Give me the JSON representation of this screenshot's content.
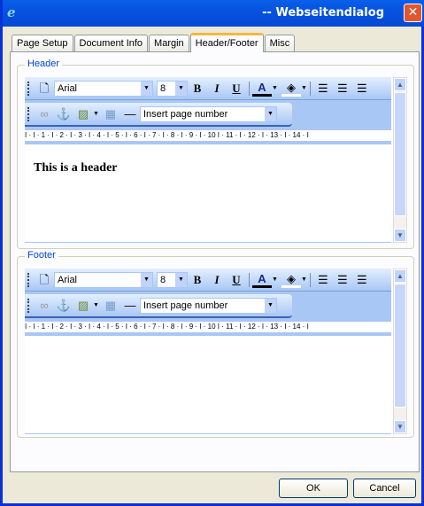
{
  "window": {
    "title": "-- Webseitendialog",
    "icon": "ie-icon",
    "close_icon": "close-icon"
  },
  "tabs": [
    {
      "label": "Page Setup"
    },
    {
      "label": "Document Info"
    },
    {
      "label": "Margin"
    },
    {
      "label": "Header/Footer",
      "active": true
    },
    {
      "label": "Misc"
    }
  ],
  "header": {
    "legend": "Header",
    "font": "Arial",
    "size": "8",
    "insert": "Insert page number",
    "content": "This is a header"
  },
  "footer": {
    "legend": "Footer",
    "font": "Arial",
    "size": "8",
    "insert": "Insert page number",
    "content": ""
  },
  "ruler": "I · I · 1 · I · 2 · I · 3 · I · 4 · I · 5 · I · 6 · I · 7 · I · 8 · I · 9 · I · 10 I · 11 · I · 12 · I · 13 · I · 14 · I",
  "buttons": {
    "ok": "OK",
    "cancel": "Cancel"
  },
  "colors": {
    "titlebar": "#0553e0",
    "toolbar": "#a8c7f5",
    "legend": "#0046d5",
    "active_tab_accent": "#f6b740"
  }
}
